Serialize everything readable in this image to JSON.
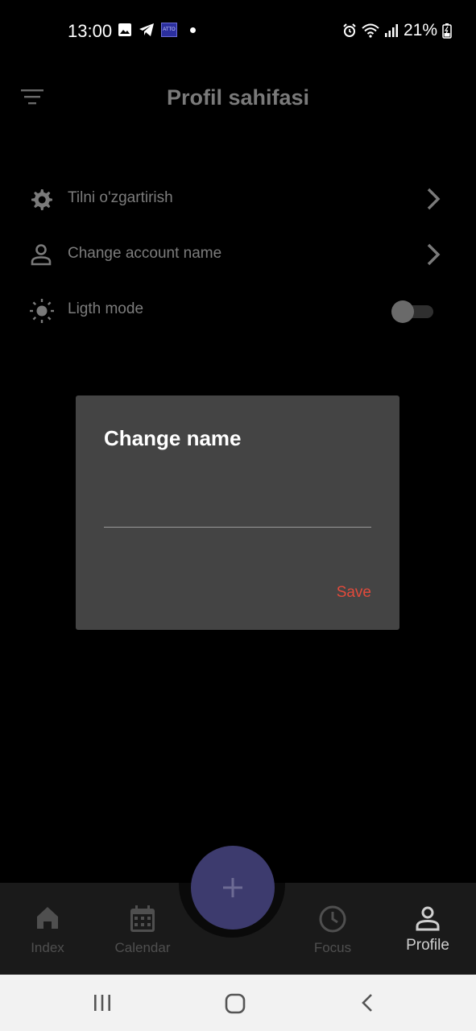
{
  "status_bar": {
    "time": "13:00",
    "battery": "21%",
    "badge": "ATTO"
  },
  "header": {
    "title": "Profil sahifasi"
  },
  "settings": [
    {
      "label": "Tilni o'zgartirish",
      "icon": "gear-icon"
    },
    {
      "label": "Change account name",
      "icon": "person-icon"
    },
    {
      "label": "Ligth mode",
      "icon": "sun-icon",
      "toggle_on": false
    }
  ],
  "dialog": {
    "title": "Change name",
    "input_value": "",
    "save_label": "Save"
  },
  "bottom_nav": {
    "items": [
      {
        "label": "Index",
        "icon": "home-icon"
      },
      {
        "label": "Calendar",
        "icon": "calendar-icon"
      },
      {
        "label": "Focus",
        "icon": "clock-icon"
      },
      {
        "label": "Profile",
        "icon": "person-icon",
        "active": true
      }
    ],
    "fab_icon": "plus-icon"
  },
  "colors": {
    "accent": "#e24a3b",
    "fab": "#3d3b6e",
    "dialog_bg": "#444444"
  }
}
